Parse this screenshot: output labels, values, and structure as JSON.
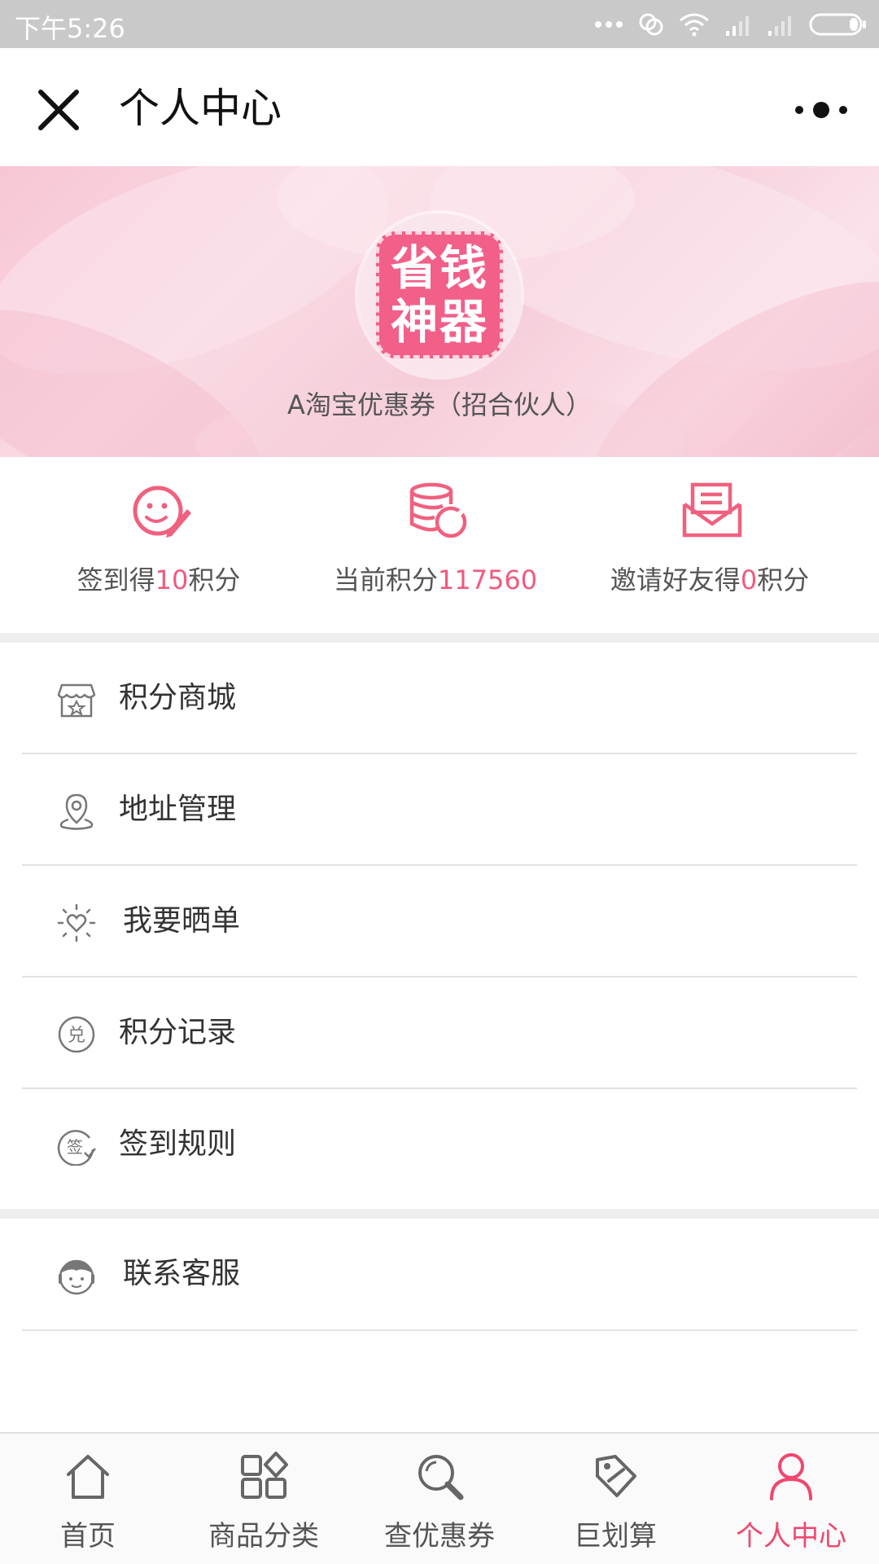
{
  "status_bar": {
    "time": "下午5:26"
  },
  "header": {
    "title": "个人中心"
  },
  "banner": {
    "logo_line1": "省钱",
    "logo_line2": "神器",
    "shop_name": "A淘宝优惠券（招合伙人）"
  },
  "stats": [
    {
      "prefix": "签到得",
      "value": "10",
      "suffix": "积分",
      "icon": "smiley-pen-icon"
    },
    {
      "prefix": "当前积分",
      "value": "117560",
      "suffix": "",
      "icon": "coins-icon"
    },
    {
      "prefix": "邀请好友得",
      "value": "0",
      "suffix": "积分",
      "icon": "envelope-icon"
    }
  ],
  "menu": [
    {
      "label": "积分商城",
      "icon": "store-icon"
    },
    {
      "label": "地址管理",
      "icon": "location-pin-icon"
    },
    {
      "label": "我要晒单",
      "icon": "heart-sun-icon"
    },
    {
      "label": "积分记录",
      "icon": "exchange-badge-icon"
    },
    {
      "label": "签到规则",
      "icon": "sign-badge-icon"
    },
    {
      "label": "联系客服",
      "icon": "customer-service-icon"
    }
  ],
  "tabs": [
    {
      "label": "首页",
      "icon": "home-icon"
    },
    {
      "label": "商品分类",
      "icon": "category-icon"
    },
    {
      "label": "查优惠券",
      "icon": "search-icon"
    },
    {
      "label": "巨划算",
      "icon": "tag-icon"
    },
    {
      "label": "个人中心",
      "icon": "user-icon",
      "active": true
    }
  ],
  "colors": {
    "accent": "#f0476f",
    "highlight": "#f05a7e",
    "status_bar": "#c9c9c9"
  }
}
